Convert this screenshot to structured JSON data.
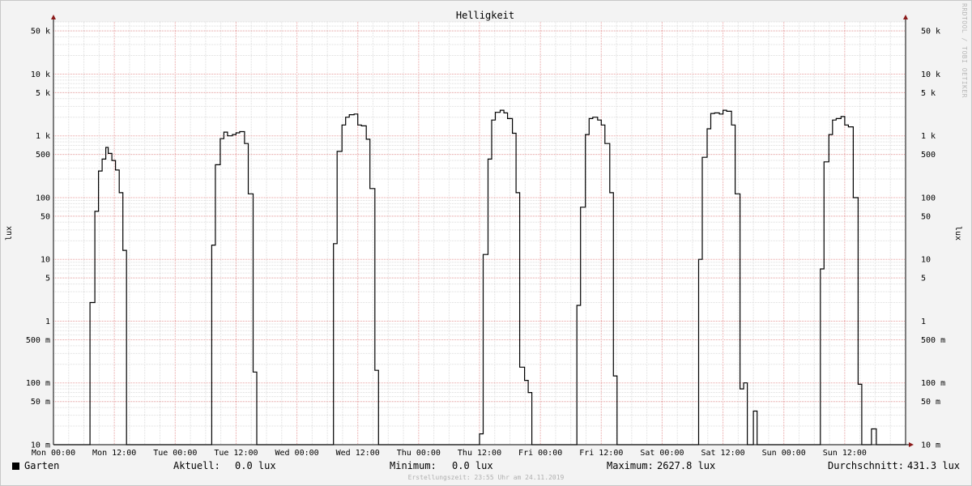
{
  "chart_data": {
    "type": "line",
    "title": "Helligkeit",
    "ylabel": "lux",
    "yscale": "log",
    "ylim": [
      0.01,
      70000
    ],
    "ytick_values": [
      0.01,
      0.05,
      0.1,
      0.5,
      1,
      5,
      10,
      50,
      100,
      500,
      1000,
      5000,
      10000,
      50000
    ],
    "ytick_labels": [
      "10 m",
      "50 m",
      "100 m",
      "500 m",
      "1",
      "5",
      "10",
      "50",
      "100",
      "500",
      "1 k",
      "5 k",
      "10 k",
      "50 k"
    ],
    "xlim": [
      0,
      7
    ],
    "xticks": [
      {
        "x": 0,
        "label": "Mon 00:00"
      },
      {
        "x": 0.5,
        "label": "Mon 12:00"
      },
      {
        "x": 1,
        "label": "Tue 00:00"
      },
      {
        "x": 1.5,
        "label": "Tue 12:00"
      },
      {
        "x": 2,
        "label": "Wed 00:00"
      },
      {
        "x": 2.5,
        "label": "Wed 12:00"
      },
      {
        "x": 3,
        "label": "Thu 00:00"
      },
      {
        "x": 3.5,
        "label": "Thu 12:00"
      },
      {
        "x": 4,
        "label": "Fri 00:00"
      },
      {
        "x": 4.5,
        "label": "Fri 12:00"
      },
      {
        "x": 5,
        "label": "Sat 00:00"
      },
      {
        "x": 5.5,
        "label": "Sat 12:00"
      },
      {
        "x": 6,
        "label": "Sun 00:00"
      },
      {
        "x": 6.5,
        "label": "Sun 12:00"
      }
    ],
    "grid": true,
    "series": [
      {
        "name": "Garten",
        "color": "#000000",
        "step": true,
        "points": [
          [
            0,
            0
          ],
          [
            0.3,
            0
          ],
          [
            0.3,
            2
          ],
          [
            0.34,
            60
          ],
          [
            0.37,
            270
          ],
          [
            0.4,
            420
          ],
          [
            0.43,
            650
          ],
          [
            0.45,
            520
          ],
          [
            0.48,
            400
          ],
          [
            0.51,
            280
          ],
          [
            0.54,
            120
          ],
          [
            0.57,
            14
          ],
          [
            0.6,
            0
          ],
          [
            1.3,
            0
          ],
          [
            1.3,
            17
          ],
          [
            1.33,
            340
          ],
          [
            1.37,
            900
          ],
          [
            1.4,
            1150
          ],
          [
            1.43,
            1000
          ],
          [
            1.47,
            1050
          ],
          [
            1.5,
            1120
          ],
          [
            1.53,
            1170
          ],
          [
            1.57,
            750
          ],
          [
            1.6,
            115
          ],
          [
            1.64,
            0.15
          ],
          [
            1.67,
            0
          ],
          [
            2.3,
            0
          ],
          [
            2.3,
            18
          ],
          [
            2.33,
            560
          ],
          [
            2.37,
            1500
          ],
          [
            2.4,
            2000
          ],
          [
            2.43,
            2200
          ],
          [
            2.47,
            2250
          ],
          [
            2.5,
            1500
          ],
          [
            2.53,
            1450
          ],
          [
            2.57,
            880
          ],
          [
            2.6,
            140
          ],
          [
            2.64,
            0.16
          ],
          [
            2.67,
            0
          ],
          [
            3.5,
            0
          ],
          [
            3.5,
            0.015
          ],
          [
            3.53,
            12
          ],
          [
            3.57,
            420
          ],
          [
            3.6,
            1800
          ],
          [
            3.63,
            2400
          ],
          [
            3.67,
            2600
          ],
          [
            3.7,
            2350
          ],
          [
            3.73,
            1900
          ],
          [
            3.77,
            1100
          ],
          [
            3.8,
            120
          ],
          [
            3.83,
            0.18
          ],
          [
            3.87,
            0.11
          ],
          [
            3.9,
            0.07
          ],
          [
            3.93,
            0
          ],
          [
            4.3,
            0
          ],
          [
            4.3,
            1.8
          ],
          [
            4.33,
            70
          ],
          [
            4.37,
            1050
          ],
          [
            4.4,
            1900
          ],
          [
            4.43,
            2000
          ],
          [
            4.47,
            1800
          ],
          [
            4.5,
            1500
          ],
          [
            4.53,
            750
          ],
          [
            4.57,
            120
          ],
          [
            4.6,
            0.13
          ],
          [
            4.63,
            0
          ],
          [
            5.3,
            0
          ],
          [
            5.3,
            10
          ],
          [
            5.33,
            450
          ],
          [
            5.37,
            1300
          ],
          [
            5.4,
            2300
          ],
          [
            5.43,
            2350
          ],
          [
            5.47,
            2250
          ],
          [
            5.5,
            2600
          ],
          [
            5.53,
            2500
          ],
          [
            5.57,
            1500
          ],
          [
            5.6,
            115
          ],
          [
            5.64,
            0.08
          ],
          [
            5.67,
            0.1
          ],
          [
            5.7,
            0
          ],
          [
            5.75,
            0.035
          ],
          [
            5.78,
            0
          ],
          [
            6.3,
            0
          ],
          [
            6.3,
            7
          ],
          [
            6.33,
            380
          ],
          [
            6.37,
            1050
          ],
          [
            6.4,
            1800
          ],
          [
            6.43,
            1900
          ],
          [
            6.47,
            2050
          ],
          [
            6.5,
            1500
          ],
          [
            6.53,
            1400
          ],
          [
            6.57,
            100
          ],
          [
            6.61,
            0.095
          ],
          [
            6.64,
            0
          ],
          [
            6.72,
            0
          ],
          [
            6.72,
            0.018
          ],
          [
            6.76,
            0
          ],
          [
            7,
            0
          ]
        ]
      }
    ]
  },
  "legend": {
    "series_name": "Garten",
    "aktuell_label": "Aktuell:",
    "aktuell_value": "0.0 lux",
    "minimum_label": "Minimum:",
    "minimum_value": "0.0 lux",
    "maximum_label": "Maximum:",
    "maximum_value": "2627.8 lux",
    "durchschnitt_label": "Durchschnitt:",
    "durchschnitt_value": "431.3 lux"
  },
  "footer": "Erstellungszeit: 23:55 Uhr am 24.11.2019",
  "watermark": "RRDTOOL / TOBI OETIKER",
  "colors": {
    "background": "#f3f3f3",
    "plot_background": "#ffffff",
    "major_grid": "#e8a0a0",
    "minor_grid": "#dddddd",
    "axis": "#000000",
    "arrow": "#8b1a1a"
  }
}
